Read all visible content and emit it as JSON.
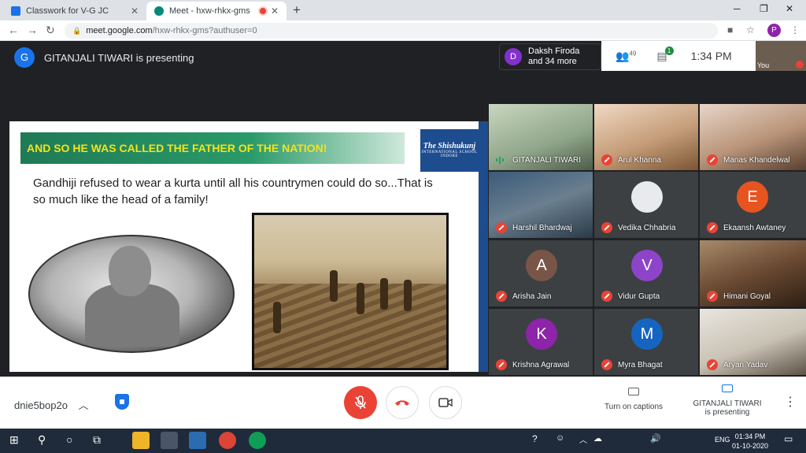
{
  "browser": {
    "tabs": [
      {
        "title": "Classwork for V-G JC"
      },
      {
        "title": "Meet - hxw-rhkx-gms"
      }
    ],
    "url_host": "meet.google.com",
    "url_path": "/hxw-rhkx-gms?authuser=0",
    "profile_initial": "P"
  },
  "meet": {
    "presenter_initial": "G",
    "presenting_text": "GITANJALI TIWARI is presenting",
    "preview": {
      "initial": "D",
      "line1": "Daksh Firoda",
      "line2": "and 34 more"
    },
    "people_count": "49",
    "chat_badge": "1",
    "time": "1:34 PM",
    "self_label": "You",
    "slide": {
      "banner": "AND SO HE WAS CALLED THE FATHER OF THE NATION!",
      "logo_name": "The Shishukunj",
      "logo_sub": "INTERNATIONAL SCHOOL",
      "logo_city": "INDORE",
      "text": "Gandhiji refused to wear a kurta until all his countrymen could do so...That is so much like the head of a family!"
    },
    "participants": [
      {
        "name": "GITANJALI TIWARI",
        "initial": "",
        "muted": false
      },
      {
        "name": "Arul Khanna",
        "initial": "",
        "muted": true
      },
      {
        "name": "Manas Khandelwal",
        "initial": "",
        "muted": true
      },
      {
        "name": "Harshil Bhardwaj",
        "initial": "",
        "muted": true
      },
      {
        "name": "Vedika Chhabria",
        "initial": "",
        "muted": true
      },
      {
        "name": "Ekaansh Awtaney",
        "initial": "E",
        "muted": true
      },
      {
        "name": "Arisha Jain",
        "initial": "A",
        "muted": true
      },
      {
        "name": "Vidur Gupta",
        "initial": "V",
        "muted": true
      },
      {
        "name": "Himani Goyal",
        "initial": "",
        "muted": true
      },
      {
        "name": "Krishna Agrawal",
        "initial": "K",
        "muted": true
      },
      {
        "name": "Myra Bhagat",
        "initial": "M",
        "muted": true
      },
      {
        "name": "Aryan Yadav",
        "initial": "",
        "muted": true
      }
    ],
    "bottom": {
      "meeting_code": "dnie5bop2o",
      "captions_label": "Turn on captions",
      "presenting_line1": "GITANJALI TIWARI",
      "presenting_line2": "is presenting"
    }
  },
  "taskbar": {
    "time": "01:34 PM",
    "date": "01-10-2020",
    "lang": "ENG"
  },
  "colors": {
    "meet_bg": "#202124",
    "red": "#ea4335",
    "blue": "#1a73e8",
    "banner_text": "#f4e31a"
  }
}
